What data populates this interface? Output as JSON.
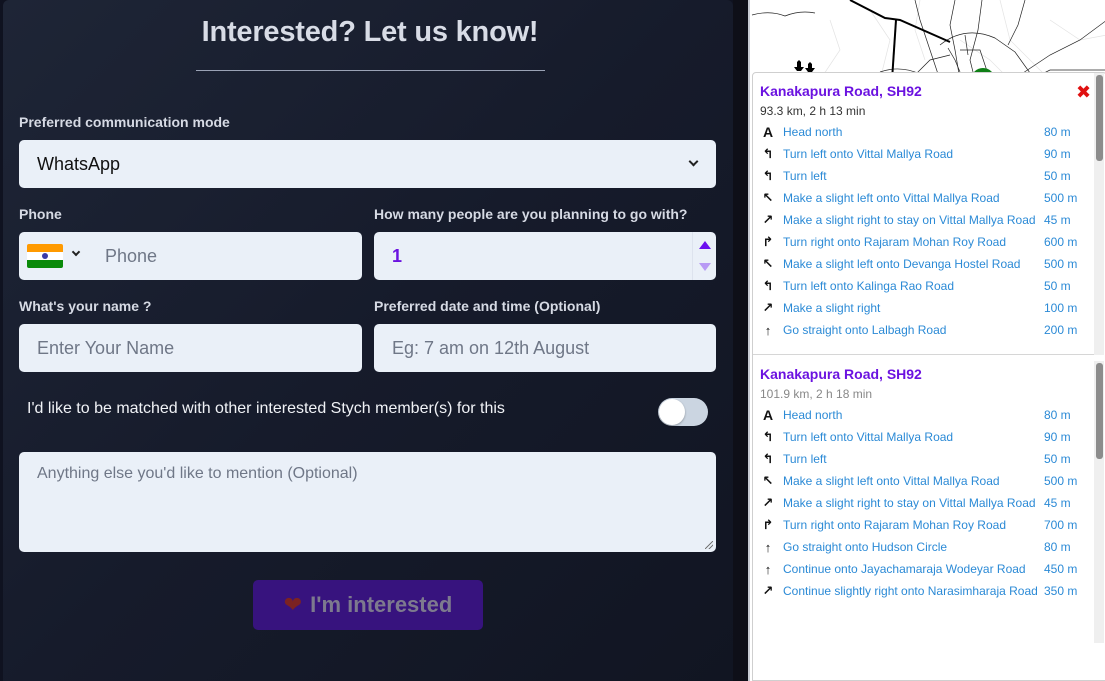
{
  "form": {
    "title": "Interested? Let us know!",
    "comm_mode": {
      "label": "Preferred communication mode",
      "value": "WhatsApp"
    },
    "phone": {
      "label": "Phone",
      "placeholder": "Phone",
      "country": "India"
    },
    "people": {
      "label": "How many people are you planning to go with?",
      "value": "1"
    },
    "name": {
      "label": "What's your name ?",
      "placeholder": "Enter Your Name"
    },
    "datetime": {
      "label": "Preferred date and time (Optional)",
      "placeholder": "Eg: 7 am on 12th August"
    },
    "match_toggle": {
      "label": "I'd like to be matched with other interested Stych member(s) for this",
      "on": false
    },
    "notes": {
      "placeholder": "Anything else you'd like to mention (Optional)"
    },
    "submit": {
      "label": "I'm interested",
      "icon": "heart-icon"
    }
  },
  "colors": {
    "accent": "#6b12e0",
    "button_bg": "#37137e",
    "link": "#2b8ad6",
    "close": "#e01010"
  },
  "routes": [
    {
      "name": "Kanakapura Road, SH92",
      "summary": "93.3 km, 2 h 13 min",
      "steps": [
        {
          "icon": "depart-icon",
          "text": "Head north",
          "dist": "80 m"
        },
        {
          "icon": "turn-left-icon",
          "text": "Turn left onto Vittal Mallya Road",
          "dist": "90 m"
        },
        {
          "icon": "turn-left-icon",
          "text": "Turn left",
          "dist": "50 m"
        },
        {
          "icon": "slight-left-icon",
          "text": "Make a slight left onto Vittal Mallya Road",
          "dist": "500 m"
        },
        {
          "icon": "slight-right-icon",
          "text": "Make a slight right to stay on Vittal Mallya Road",
          "dist": "45 m"
        },
        {
          "icon": "turn-right-icon",
          "text": "Turn right onto Rajaram Mohan Roy Road",
          "dist": "600 m"
        },
        {
          "icon": "slight-left-icon",
          "text": "Make a slight left onto Devanga Hostel Road",
          "dist": "500 m"
        },
        {
          "icon": "turn-left-icon",
          "text": "Turn left onto Kalinga Rao Road",
          "dist": "50 m"
        },
        {
          "icon": "slight-right-icon",
          "text": "Make a slight right",
          "dist": "100 m"
        },
        {
          "icon": "straight-icon",
          "text": "Go straight onto Lalbagh Road",
          "dist": "200 m"
        }
      ]
    },
    {
      "name": "Kanakapura Road, SH92",
      "summary": "101.9 km, 2 h 18 min",
      "steps": [
        {
          "icon": "depart-icon",
          "text": "Head north",
          "dist": "80 m"
        },
        {
          "icon": "turn-left-icon",
          "text": "Turn left onto Vittal Mallya Road",
          "dist": "90 m"
        },
        {
          "icon": "turn-left-icon",
          "text": "Turn left",
          "dist": "50 m"
        },
        {
          "icon": "slight-left-icon",
          "text": "Make a slight left onto Vittal Mallya Road",
          "dist": "500 m"
        },
        {
          "icon": "slight-right-icon",
          "text": "Make a slight right to stay on Vittal Mallya Road",
          "dist": "45 m"
        },
        {
          "icon": "turn-right-icon",
          "text": "Turn right onto Rajaram Mohan Roy Road",
          "dist": "700 m"
        },
        {
          "icon": "straight-icon",
          "text": "Go straight onto Hudson Circle",
          "dist": "80 m"
        },
        {
          "icon": "straight-icon",
          "text": "Continue onto Jayachamaraja Wodeyar Road",
          "dist": "450 m"
        },
        {
          "icon": "slight-right-icon",
          "text": "Continue slightly right onto Narasimharaja Road",
          "dist": "350 m"
        }
      ]
    }
  ]
}
